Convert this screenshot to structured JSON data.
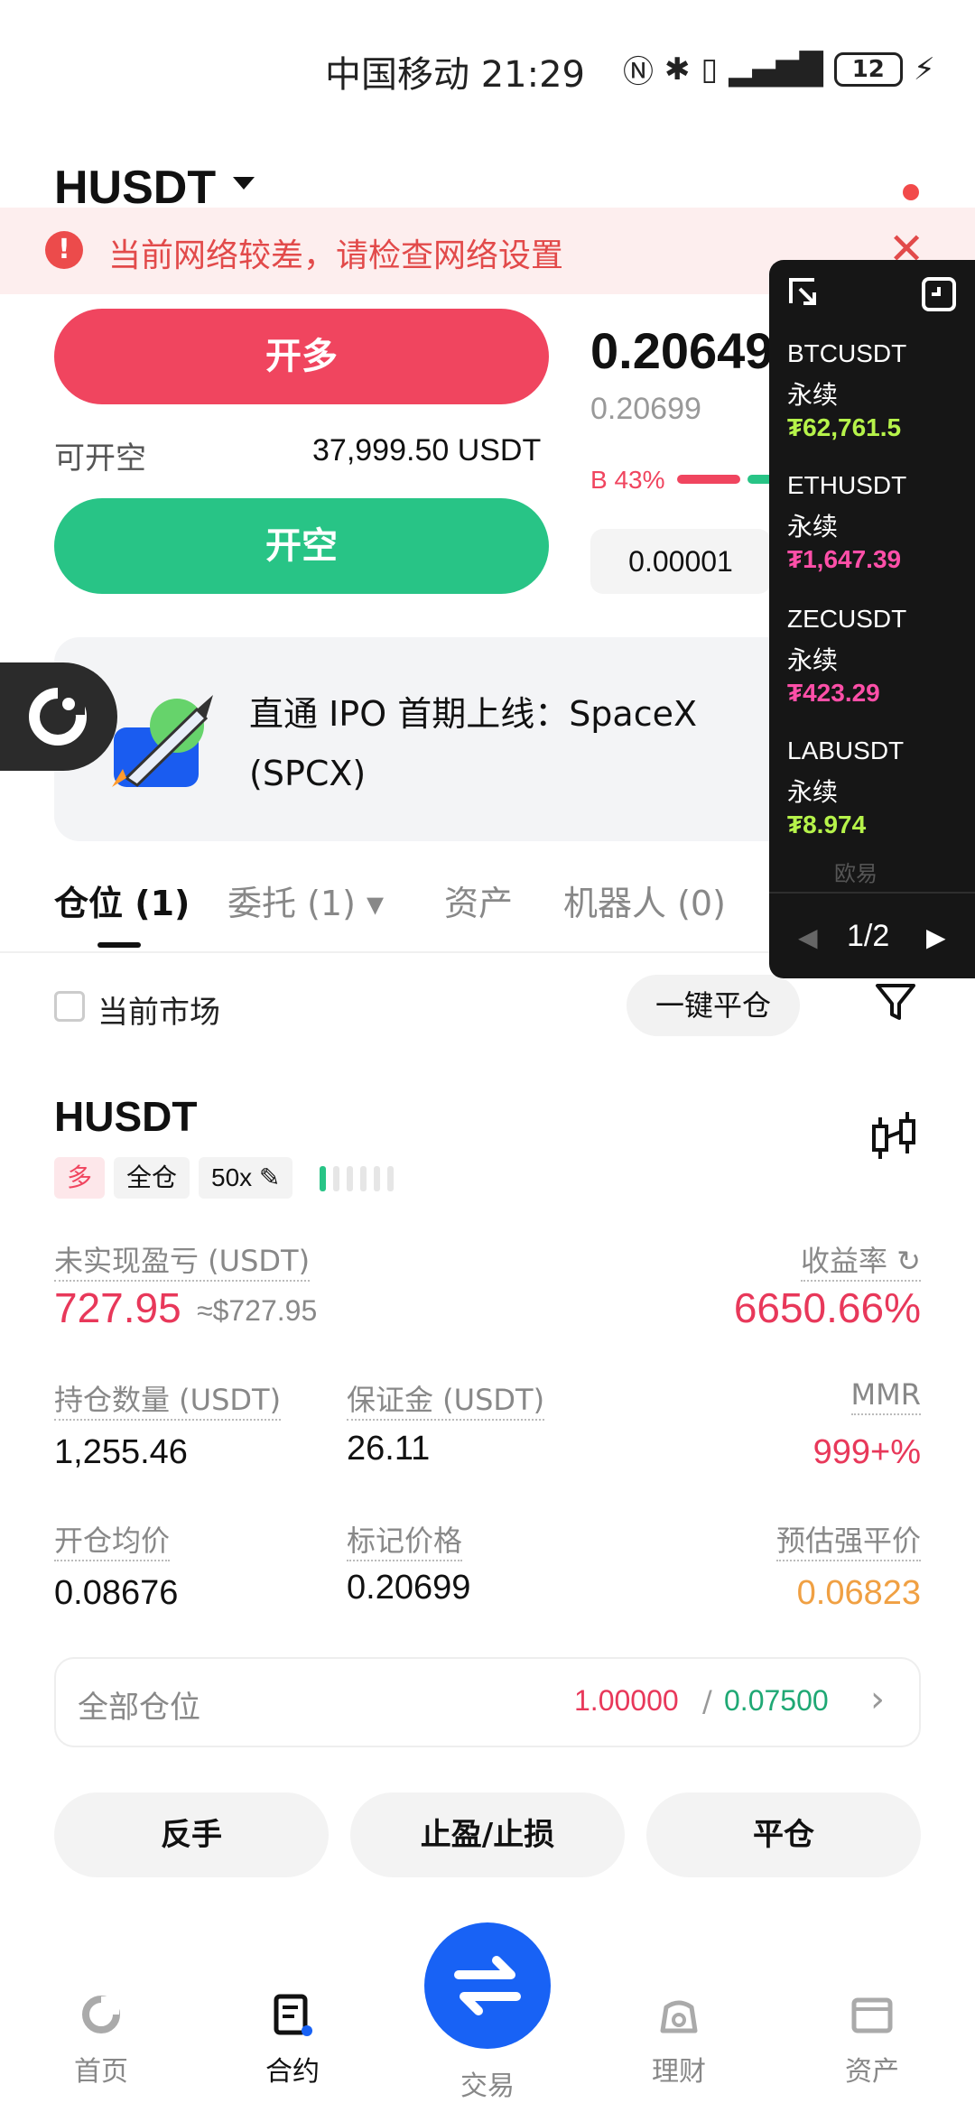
{
  "status_bar": {
    "carrier_time": "中国移动 21:29",
    "battery": "12"
  },
  "header": {
    "pair": "HUSDT"
  },
  "warning": {
    "icon": "!",
    "text": "当前网络较差，请检查网络设置",
    "close": "✕"
  },
  "order": {
    "long_label": "开多",
    "short_label": "开空",
    "available_label": "可开空",
    "available_value": "37,999.50 USDT",
    "last_price": "0.20649",
    "mark_price": "0.20699",
    "buy_ratio": "B 43%",
    "step": "0.00001"
  },
  "banner": {
    "text": "直通 IPO 首期上线：SpaceX (SPCX)"
  },
  "tabs": [
    {
      "label": "仓位 (1)"
    },
    {
      "label": "委托 (1) ▾"
    },
    {
      "label": "资产"
    },
    {
      "label": "机器人 (0)"
    }
  ],
  "filter": {
    "market_label": "当前市场",
    "close_all": "一键平仓"
  },
  "position": {
    "symbol": "HUSDT",
    "side_tag": "多",
    "margin_tag": "全仓",
    "leverage_tag": "50x ✎",
    "pnl_label": "未实现盈亏 (USDT)",
    "pnl_value": "727.95",
    "pnl_usd": "≈$727.95",
    "roi_label": "收益率 ↻",
    "roi_value": "6650.66%",
    "size_label": "持仓数量 (USDT)",
    "size_value": "1,255.46",
    "margin_label": "保证金 (USDT)",
    "margin_value": "26.11",
    "mmr_label": "MMR",
    "mmr_value": "999+%",
    "entry_label": "开仓均价",
    "entry_value": "0.08676",
    "mark_label": "标记价格",
    "mark_value": "0.20699",
    "liq_label": "预估强平价",
    "liq_value": "0.06823",
    "all_label": "全部仓位",
    "all_red": "1.00000",
    "all_sep": "/",
    "all_green": "0.07500",
    "chevron": "›"
  },
  "actions": {
    "reverse": "反手",
    "tpsl": "止盈/止损",
    "close": "平仓"
  },
  "nav": {
    "home": "首页",
    "futures": "合约",
    "trade": "交易",
    "finance": "理财",
    "assets": "资产"
  },
  "ticker": {
    "items": [
      {
        "symbol": "BTCUSDT",
        "type": "永续",
        "price": "₮62,761.5",
        "color": "#b6f34a"
      },
      {
        "symbol": "ETHUSDT",
        "type": "永续",
        "price": "₮1,647.39",
        "color": "#ff4fa8"
      },
      {
        "symbol": "ZECUSDT",
        "type": "永续",
        "price": "₮423.29",
        "color": "#ff4fa8"
      },
      {
        "symbol": "LABUSDT",
        "type": "永续",
        "price": "₮8.974",
        "color": "#b6f34a"
      }
    ],
    "logo": "欧易",
    "page": "1/2",
    "prev": "◀",
    "next": "▶"
  }
}
